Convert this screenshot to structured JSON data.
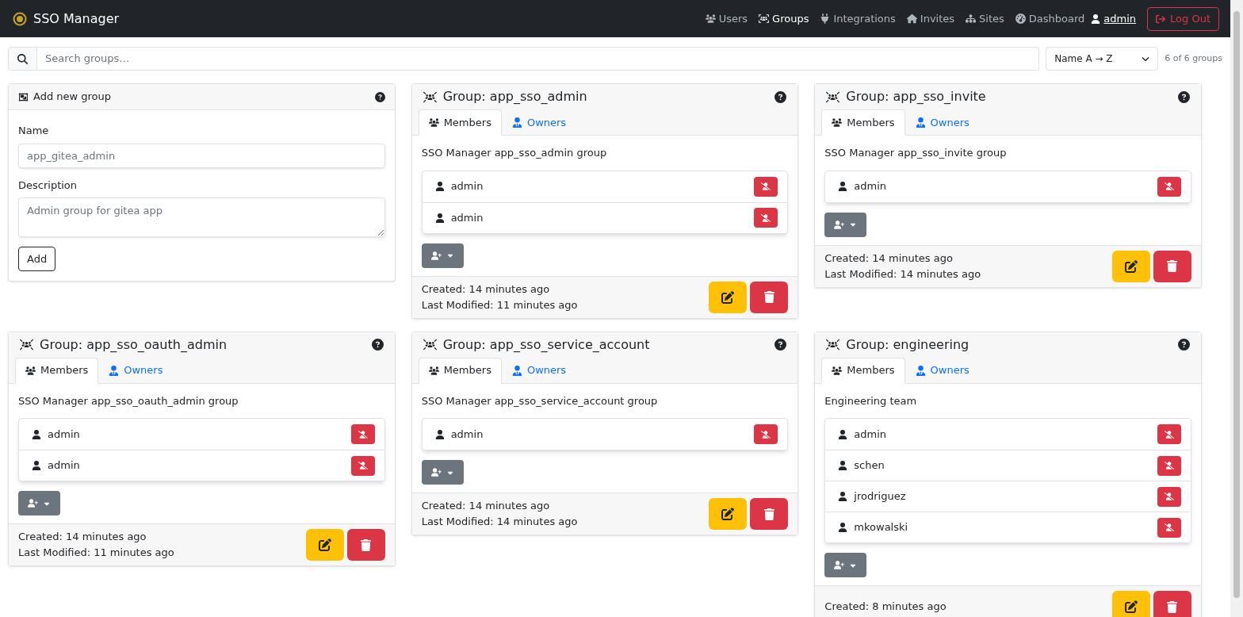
{
  "navbar": {
    "brand": "SSO Manager",
    "links": [
      {
        "kind": "users",
        "label": "Users",
        "selected": false
      },
      {
        "kind": "groups",
        "label": "Groups",
        "selected": true
      },
      {
        "kind": "integrations",
        "label": "Integrations",
        "selected": false
      },
      {
        "kind": "invites",
        "label": "Invites",
        "selected": false
      },
      {
        "kind": "sites",
        "label": "Sites",
        "selected": false
      },
      {
        "kind": "dashboard",
        "label": "Dashboard",
        "selected": false
      }
    ],
    "user": "admin",
    "logout": "Log Out"
  },
  "toolbar": {
    "search_placeholder": "Search groups…",
    "sort": "Name A → Z",
    "count": "6 of 6 groups"
  },
  "add_form": {
    "title": "Add new group",
    "name_label": "Name",
    "name_placeholder": "app_gitea_admin",
    "description_label": "Description",
    "description_placeholder": "Admin group for gitea app",
    "submit": "Add"
  },
  "groups": [
    {
      "title": "Group: app_sso_admin",
      "tabs": [
        {
          "label": "Members",
          "selected": true
        },
        {
          "label": "Owners",
          "selected": false
        }
      ],
      "description": "SSO Manager app_sso_admin group",
      "members": [
        "admin",
        "admin"
      ],
      "created": "Created: 14 minutes ago",
      "modified": "Last Modified: 11 minutes ago"
    },
    {
      "title": "Group: app_sso_invite",
      "tabs": [
        {
          "label": "Members",
          "selected": true
        },
        {
          "label": "Owners",
          "selected": false
        }
      ],
      "description": "SSO Manager app_sso_invite group",
      "members": [
        "admin"
      ],
      "created": "Created: 14 minutes ago",
      "modified": "Last Modified: 14 minutes ago"
    },
    {
      "title": "Group: app_sso_oauth_admin",
      "tabs": [
        {
          "label": "Members",
          "selected": true
        },
        {
          "label": "Owners",
          "selected": false
        }
      ],
      "description": "SSO Manager app_sso_oauth_admin group",
      "members": [
        "admin",
        "admin"
      ],
      "created": "Created: 14 minutes ago",
      "modified": "Last Modified: 11 minutes ago"
    },
    {
      "title": "Group: app_sso_service_account",
      "tabs": [
        {
          "label": "Members",
          "selected": true
        },
        {
          "label": "Owners",
          "selected": false
        }
      ],
      "description": "SSO Manager app_sso_service_account group",
      "members": [
        "admin"
      ],
      "created": "Created: 14 minutes ago",
      "modified": "Last Modified: 14 minutes ago"
    },
    {
      "title": "Group: engineering",
      "tabs": [
        {
          "label": "Members",
          "selected": true
        },
        {
          "label": "Owners",
          "selected": false
        }
      ],
      "description": "Engineering team",
      "members": [
        "admin",
        "schen",
        "jrodriguez",
        "mkowalski"
      ],
      "created": "Created: 8 minutes ago"
    }
  ]
}
